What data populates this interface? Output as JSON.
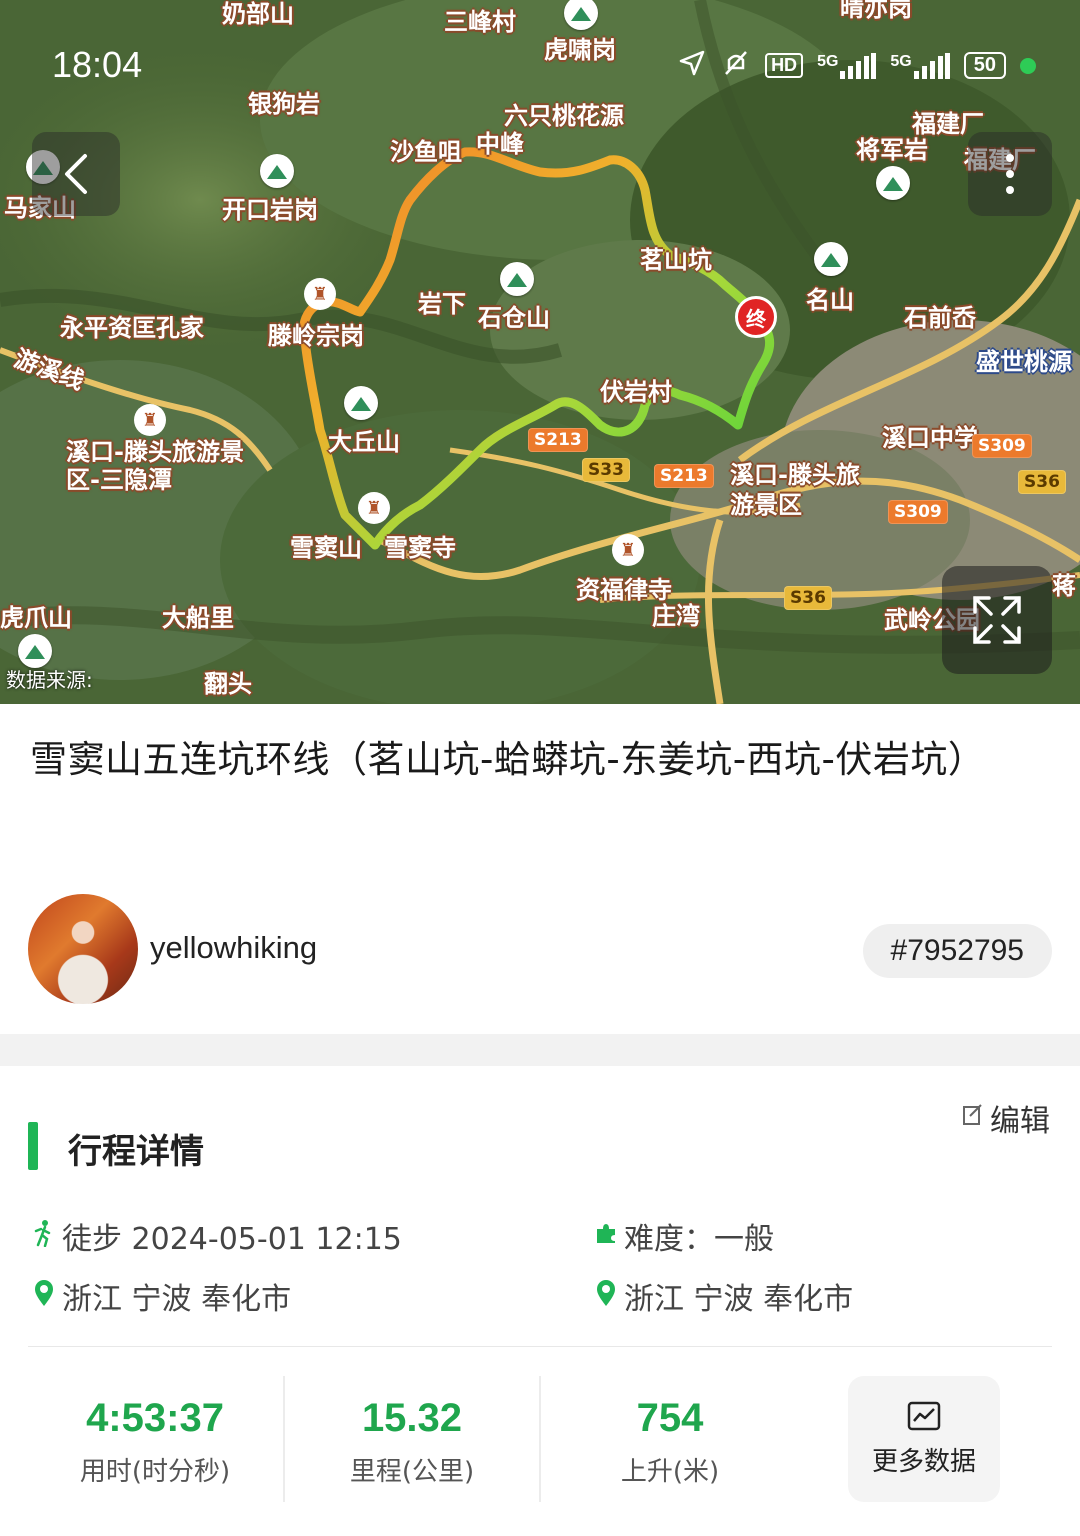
{
  "status_bar": {
    "time": "18:04",
    "hd": "HD",
    "net1": "5G",
    "net2": "5G",
    "battery": "50"
  },
  "map": {
    "data_source": "数据来源:",
    "end_marker": "终",
    "labels": [
      "奶部山",
      "三峰村",
      "虎啸岗",
      "晴亦岗",
      "银狗岩",
      "六只桃花源",
      "沙鱼咀",
      "中峰",
      "马家山",
      "开口岩岗",
      "福建厂",
      "将军岩",
      "福建厂",
      "岩下",
      "石仓山",
      "茗山坑",
      "名山",
      "石前岙",
      "永平资匡孔家",
      "滕岭宗岗",
      "盛世桃源",
      "游溪线",
      "溪口-滕头旅游景区-三隐潭",
      "岩下",
      "大丘山",
      "伏岩村",
      "溪口中学",
      "溪口-滕头旅游景区",
      "雪窦山",
      "雪窦寺",
      "资福律寺",
      "庄湾",
      "虎爪山",
      "大船里",
      "翻头",
      "武岭公园",
      "蒋"
    ],
    "roads": [
      "S213",
      "S33",
      "S213",
      "S309",
      "S309",
      "S36",
      "S36"
    ]
  },
  "route": {
    "title": "雪窦山五连坑环线（茗山坑-蛤蟒坑-东姜坑-西坑-伏岩坑）"
  },
  "user": {
    "name": "yellowhiking",
    "track_id": "#7952795"
  },
  "details": {
    "section_title": "行程详情",
    "edit_label": "编辑",
    "activity": "徒步 2024-05-01 12:15",
    "difficulty": "难度：一般",
    "start_location": "浙江 宁波 奉化市",
    "end_location": "浙江 宁波 奉化市"
  },
  "stats": [
    {
      "value": "4:53:37",
      "label": "用时(时分秒)"
    },
    {
      "value": "15.32",
      "label": "里程(公里)"
    },
    {
      "value": "754",
      "label": "上升(米)"
    }
  ],
  "more_data_label": "更多数据",
  "colors": {
    "accent": "#1fb556",
    "route_start": "#f07d28",
    "route_end": "#3fd23a",
    "end_marker": "#e02424"
  }
}
